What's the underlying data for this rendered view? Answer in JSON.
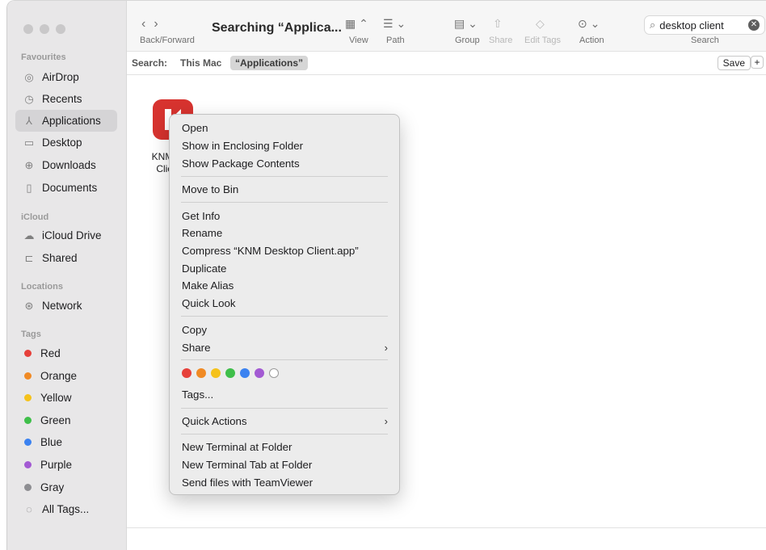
{
  "sidebar": {
    "favourites_title": "Favourites",
    "icloud_title": "iCloud",
    "locations_title": "Locations",
    "tags_title": "Tags",
    "favourites": [
      {
        "label": "AirDrop",
        "icon": "airdrop-icon"
      },
      {
        "label": "Recents",
        "icon": "clock-icon"
      },
      {
        "label": "Applications",
        "icon": "applications-icon"
      },
      {
        "label": "Desktop",
        "icon": "desktop-icon"
      },
      {
        "label": "Downloads",
        "icon": "download-icon"
      },
      {
        "label": "Documents",
        "icon": "document-icon"
      }
    ],
    "icloud": [
      {
        "label": "iCloud Drive",
        "icon": "cloud-icon"
      },
      {
        "label": "Shared",
        "icon": "shared-folder-icon"
      }
    ],
    "locations": [
      {
        "label": "Network",
        "icon": "globe-icon"
      }
    ],
    "tags": [
      {
        "label": "Red",
        "color": "#e6403a"
      },
      {
        "label": "Orange",
        "color": "#f08a24"
      },
      {
        "label": "Yellow",
        "color": "#f5c21b"
      },
      {
        "label": "Green",
        "color": "#3fbf4a"
      },
      {
        "label": "Blue",
        "color": "#3b82f0"
      },
      {
        "label": "Purple",
        "color": "#a35ad3"
      },
      {
        "label": "Gray",
        "color": "#8e8e92"
      }
    ],
    "all_tags": "All Tags..."
  },
  "toolbar": {
    "back_forward_label": "Back/Forward",
    "title": "Searching “Applica...",
    "view_label": "View",
    "path_label": "Path",
    "group_label": "Group",
    "share_label": "Share",
    "edit_tags_label": "Edit Tags",
    "action_label": "Action",
    "search_value": "desktop client",
    "search_label": "Search"
  },
  "scope": {
    "label": "Search:",
    "this_mac": "This Mac",
    "applications": "“Applications”",
    "save": "Save",
    "plus": "+"
  },
  "file": {
    "name_line1": "KNM D",
    "name_line2": "Clien"
  },
  "menu": {
    "open": "Open",
    "show_enclosing": "Show in Enclosing Folder",
    "show_package": "Show Package Contents",
    "move_to_bin": "Move to Bin",
    "get_info": "Get Info",
    "rename": "Rename",
    "compress": "Compress “KNM Desktop Client.app”",
    "duplicate": "Duplicate",
    "make_alias": "Make Alias",
    "quick_look": "Quick Look",
    "copy": "Copy",
    "share": "Share",
    "tag_colors": [
      "#e6403a",
      "#f08a24",
      "#f5c21b",
      "#3fbf4a",
      "#3b82f0",
      "#a35ad3"
    ],
    "tags": "Tags...",
    "quick_actions": "Quick Actions",
    "new_terminal": "New Terminal at Folder",
    "new_terminal_tab": "New Terminal Tab at Folder",
    "send_teamviewer": "Send files with TeamViewer"
  }
}
